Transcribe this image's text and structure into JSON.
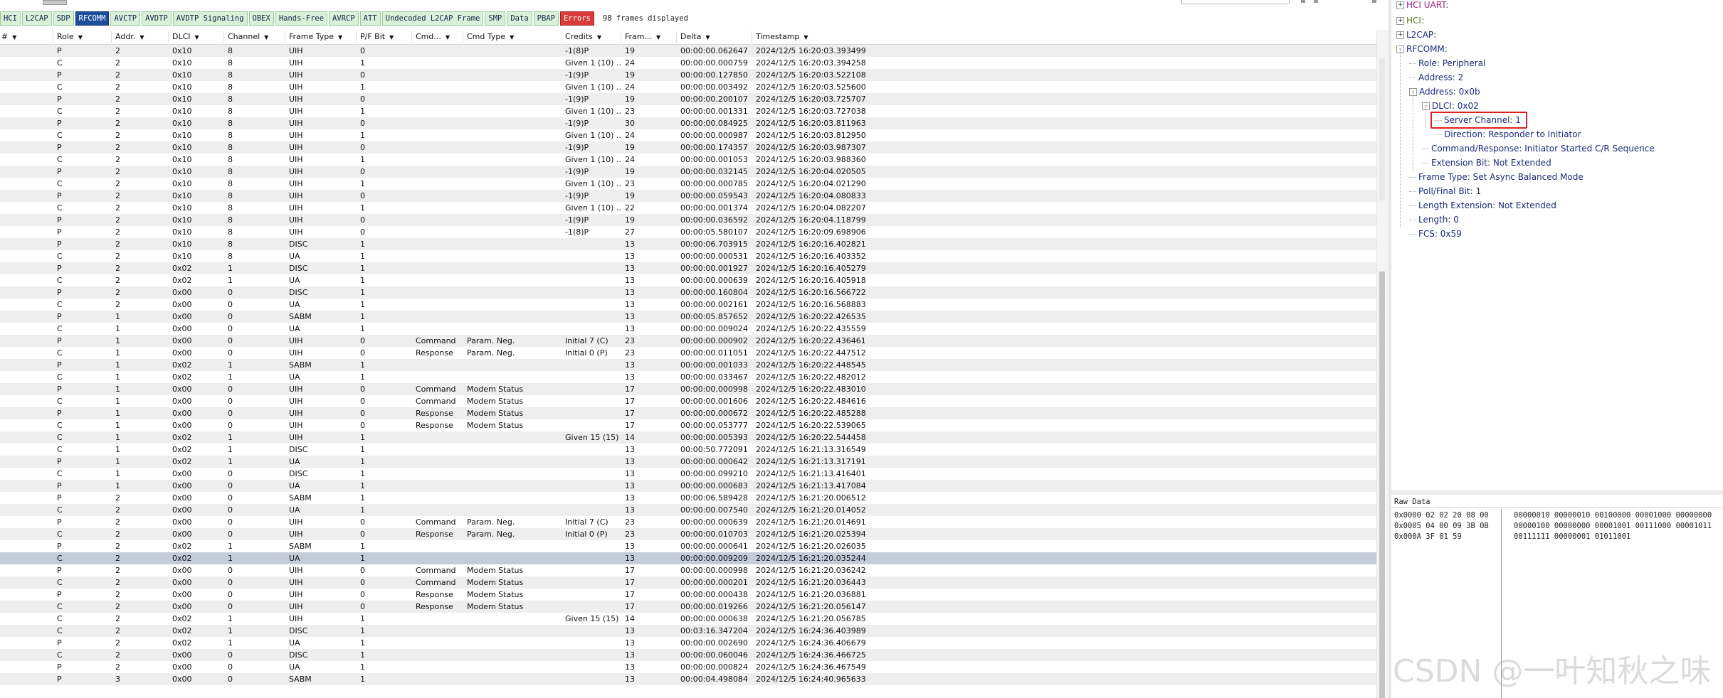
{
  "filter_bar": {
    "tabs": [
      {
        "label": "HCI",
        "state": "normal"
      },
      {
        "label": "L2CAP",
        "state": "normal"
      },
      {
        "label": "SDP",
        "state": "normal"
      },
      {
        "label": "RFCOMM",
        "state": "active"
      },
      {
        "label": "AVCTP",
        "state": "normal"
      },
      {
        "label": "AVDTP",
        "state": "normal"
      },
      {
        "label": "AVDTP Signaling",
        "state": "normal"
      },
      {
        "label": "OBEX",
        "state": "normal"
      },
      {
        "label": "Hands-Free",
        "state": "normal"
      },
      {
        "label": "AVRCP",
        "state": "normal"
      },
      {
        "label": "ATT",
        "state": "normal"
      },
      {
        "label": "Undecoded L2CAP Frame",
        "state": "normal"
      },
      {
        "label": "SMP",
        "state": "normal"
      },
      {
        "label": "Data",
        "state": "normal"
      },
      {
        "label": "PBAP",
        "state": "normal"
      },
      {
        "label": "Errors",
        "state": "error"
      }
    ],
    "frames_displayed": "98 frames displayed"
  },
  "table": {
    "headers": [
      "#",
      "Role",
      "Addr.",
      "DLCI",
      "Channel",
      "Frame Type",
      "P/F Bit",
      "Cmd...",
      "Cmd Type",
      "Credits",
      "Fram...",
      "Delta",
      "Timestamp"
    ],
    "selected_row": 42,
    "rows": [
      [
        "",
        "P",
        "2",
        "0x10",
        "8",
        "UIH",
        "0",
        "",
        "",
        "-1(8)P",
        "19",
        "00:00:00.062647",
        "2024/12/5 16:20:03.393499"
      ],
      [
        "",
        "C",
        "2",
        "0x10",
        "8",
        "UIH",
        "1",
        "",
        "",
        "Given 1 (10) ...",
        "24",
        "00:00:00.000759",
        "2024/12/5 16:20:03.394258"
      ],
      [
        "",
        "P",
        "2",
        "0x10",
        "8",
        "UIH",
        "0",
        "",
        "",
        "-1(9)P",
        "19",
        "00:00:00.127850",
        "2024/12/5 16:20:03.522108"
      ],
      [
        "",
        "C",
        "2",
        "0x10",
        "8",
        "UIH",
        "1",
        "",
        "",
        "Given 1 (10) ...",
        "24",
        "00:00:00.003492",
        "2024/12/5 16:20:03.525600"
      ],
      [
        "",
        "P",
        "2",
        "0x10",
        "8",
        "UIH",
        "0",
        "",
        "",
        "-1(9)P",
        "19",
        "00:00:00.200107",
        "2024/12/5 16:20:03.725707"
      ],
      [
        "",
        "C",
        "2",
        "0x10",
        "8",
        "UIH",
        "1",
        "",
        "",
        "Given 1 (10) ...",
        "23",
        "00:00:00.001331",
        "2024/12/5 16:20:03.727038"
      ],
      [
        "",
        "P",
        "2",
        "0x10",
        "8",
        "UIH",
        "0",
        "",
        "",
        "-1(9)P",
        "30",
        "00:00:00.084925",
        "2024/12/5 16:20:03.811963"
      ],
      [
        "",
        "C",
        "2",
        "0x10",
        "8",
        "UIH",
        "1",
        "",
        "",
        "Given 1 (10) ...",
        "24",
        "00:00:00.000987",
        "2024/12/5 16:20:03.812950"
      ],
      [
        "",
        "P",
        "2",
        "0x10",
        "8",
        "UIH",
        "0",
        "",
        "",
        "-1(9)P",
        "19",
        "00:00:00.174357",
        "2024/12/5 16:20:03.987307"
      ],
      [
        "",
        "C",
        "2",
        "0x10",
        "8",
        "UIH",
        "1",
        "",
        "",
        "Given 1 (10) ...",
        "24",
        "00:00:00.001053",
        "2024/12/5 16:20:03.988360"
      ],
      [
        "",
        "P",
        "2",
        "0x10",
        "8",
        "UIH",
        "0",
        "",
        "",
        "-1(9)P",
        "19",
        "00:00:00.032145",
        "2024/12/5 16:20:04.020505"
      ],
      [
        "",
        "C",
        "2",
        "0x10",
        "8",
        "UIH",
        "1",
        "",
        "",
        "Given 1 (10) ...",
        "23",
        "00:00:00.000785",
        "2024/12/5 16:20:04.021290"
      ],
      [
        "",
        "P",
        "2",
        "0x10",
        "8",
        "UIH",
        "0",
        "",
        "",
        "-1(9)P",
        "19",
        "00:00:00.059543",
        "2024/12/5 16:20:04.080833"
      ],
      [
        "",
        "C",
        "2",
        "0x10",
        "8",
        "UIH",
        "1",
        "",
        "",
        "Given 1 (10) ...",
        "22",
        "00:00:00.001374",
        "2024/12/5 16:20:04.082207"
      ],
      [
        "",
        "P",
        "2",
        "0x10",
        "8",
        "UIH",
        "0",
        "",
        "",
        "-1(9)P",
        "19",
        "00:00:00.036592",
        "2024/12/5 16:20:04.118799"
      ],
      [
        "",
        "P",
        "2",
        "0x10",
        "8",
        "UIH",
        "0",
        "",
        "",
        "-1(8)P",
        "27",
        "00:00:05.580107",
        "2024/12/5 16:20:09.698906"
      ],
      [
        "",
        "P",
        "2",
        "0x10",
        "8",
        "DISC",
        "1",
        "",
        "",
        "",
        "13",
        "00:00:06.703915",
        "2024/12/5 16:20:16.402821"
      ],
      [
        "",
        "C",
        "2",
        "0x10",
        "8",
        "UA",
        "1",
        "",
        "",
        "",
        "13",
        "00:00:00.000531",
        "2024/12/5 16:20:16.403352"
      ],
      [
        "",
        "P",
        "2",
        "0x02",
        "1",
        "DISC",
        "1",
        "",
        "",
        "",
        "13",
        "00:00:00.001927",
        "2024/12/5 16:20:16.405279"
      ],
      [
        "",
        "C",
        "2",
        "0x02",
        "1",
        "UA",
        "1",
        "",
        "",
        "",
        "13",
        "00:00:00.000639",
        "2024/12/5 16:20:16.405918"
      ],
      [
        "",
        "P",
        "2",
        "0x00",
        "0",
        "DISC",
        "1",
        "",
        "",
        "",
        "13",
        "00:00:00.160804",
        "2024/12/5 16:20:16.566722"
      ],
      [
        "",
        "C",
        "2",
        "0x00",
        "0",
        "UA",
        "1",
        "",
        "",
        "",
        "13",
        "00:00:00.002161",
        "2024/12/5 16:20:16.568883"
      ],
      [
        "",
        "P",
        "1",
        "0x00",
        "0",
        "SABM",
        "1",
        "",
        "",
        "",
        "13",
        "00:00:05.857652",
        "2024/12/5 16:20:22.426535"
      ],
      [
        "",
        "C",
        "1",
        "0x00",
        "0",
        "UA",
        "1",
        "",
        "",
        "",
        "13",
        "00:00:00.009024",
        "2024/12/5 16:20:22.435559"
      ],
      [
        "",
        "P",
        "1",
        "0x00",
        "0",
        "UIH",
        "0",
        "Command",
        "Param. Neg.",
        "Initial 7 (C)",
        "23",
        "00:00:00.000902",
        "2024/12/5 16:20:22.436461"
      ],
      [
        "",
        "C",
        "1",
        "0x00",
        "0",
        "UIH",
        "0",
        "Response",
        "Param. Neg.",
        "Initial 0 (P)",
        "23",
        "00:00:00.011051",
        "2024/12/5 16:20:22.447512"
      ],
      [
        "",
        "P",
        "1",
        "0x02",
        "1",
        "SABM",
        "1",
        "",
        "",
        "",
        "13",
        "00:00:00.001033",
        "2024/12/5 16:20:22.448545"
      ],
      [
        "",
        "C",
        "1",
        "0x02",
        "1",
        "UA",
        "1",
        "",
        "",
        "",
        "13",
        "00:00:00.033467",
        "2024/12/5 16:20:22.482012"
      ],
      [
        "",
        "P",
        "1",
        "0x00",
        "0",
        "UIH",
        "0",
        "Command",
        "Modem Status",
        "",
        "17",
        "00:00:00.000998",
        "2024/12/5 16:20:22.483010"
      ],
      [
        "",
        "C",
        "1",
        "0x00",
        "0",
        "UIH",
        "0",
        "Command",
        "Modem Status",
        "",
        "17",
        "00:00:00.001606",
        "2024/12/5 16:20:22.484616"
      ],
      [
        "",
        "P",
        "1",
        "0x00",
        "0",
        "UIH",
        "0",
        "Response",
        "Modem Status",
        "",
        "17",
        "00:00:00.000672",
        "2024/12/5 16:20:22.485288"
      ],
      [
        "",
        "C",
        "1",
        "0x00",
        "0",
        "UIH",
        "0",
        "Response",
        "Modem Status",
        "",
        "17",
        "00:00:00.053777",
        "2024/12/5 16:20:22.539065"
      ],
      [
        "",
        "C",
        "1",
        "0x02",
        "1",
        "UIH",
        "1",
        "",
        "",
        "Given 15 (15) ...",
        "14",
        "00:00:00.005393",
        "2024/12/5 16:20:22.544458"
      ],
      [
        "",
        "C",
        "1",
        "0x02",
        "1",
        "DISC",
        "1",
        "",
        "",
        "",
        "13",
        "00:00:50.772091",
        "2024/12/5 16:21:13.316549"
      ],
      [
        "",
        "P",
        "1",
        "0x02",
        "1",
        "UA",
        "1",
        "",
        "",
        "",
        "13",
        "00:00:00.000642",
        "2024/12/5 16:21:13.317191"
      ],
      [
        "",
        "C",
        "1",
        "0x00",
        "0",
        "DISC",
        "1",
        "",
        "",
        "",
        "13",
        "00:00:00.099210",
        "2024/12/5 16:21:13.416401"
      ],
      [
        "",
        "P",
        "1",
        "0x00",
        "0",
        "UA",
        "1",
        "",
        "",
        "",
        "13",
        "00:00:00.000683",
        "2024/12/5 16:21:13.417084"
      ],
      [
        "",
        "P",
        "2",
        "0x00",
        "0",
        "SABM",
        "1",
        "",
        "",
        "",
        "13",
        "00:00:06.589428",
        "2024/12/5 16:21:20.006512"
      ],
      [
        "",
        "C",
        "2",
        "0x00",
        "0",
        "UA",
        "1",
        "",
        "",
        "",
        "13",
        "00:00:00.007540",
        "2024/12/5 16:21:20.014052"
      ],
      [
        "",
        "P",
        "2",
        "0x00",
        "0",
        "UIH",
        "0",
        "Command",
        "Param. Neg.",
        "Initial 7 (C)",
        "23",
        "00:00:00.000639",
        "2024/12/5 16:21:20.014691"
      ],
      [
        "",
        "C",
        "2",
        "0x00",
        "0",
        "UIH",
        "0",
        "Response",
        "Param. Neg.",
        "Initial 0 (P)",
        "23",
        "00:00:00.010703",
        "2024/12/5 16:21:20.025394"
      ],
      [
        "",
        "P",
        "2",
        "0x02",
        "1",
        "SABM",
        "1",
        "",
        "",
        "",
        "13",
        "00:00:00.000641",
        "2024/12/5 16:21:20.026035"
      ],
      [
        "",
        "C",
        "2",
        "0x02",
        "1",
        "UA",
        "1",
        "",
        "",
        "",
        "13",
        "00:00:00.009209",
        "2024/12/5 16:21:20.035244"
      ],
      [
        "",
        "P",
        "2",
        "0x00",
        "0",
        "UIH",
        "0",
        "Command",
        "Modem Status",
        "",
        "17",
        "00:00:00.000998",
        "2024/12/5 16:21:20.036242"
      ],
      [
        "",
        "C",
        "2",
        "0x00",
        "0",
        "UIH",
        "0",
        "Command",
        "Modem Status",
        "",
        "17",
        "00:00:00.000201",
        "2024/12/5 16:21:20.036443"
      ],
      [
        "",
        "P",
        "2",
        "0x00",
        "0",
        "UIH",
        "0",
        "Response",
        "Modem Status",
        "",
        "17",
        "00:00:00.000438",
        "2024/12/5 16:21:20.036881"
      ],
      [
        "",
        "C",
        "2",
        "0x00",
        "0",
        "UIH",
        "0",
        "Response",
        "Modem Status",
        "",
        "17",
        "00:00:00.019266",
        "2024/12/5 16:21:20.056147"
      ],
      [
        "",
        "C",
        "2",
        "0x02",
        "1",
        "UIH",
        "1",
        "",
        "",
        "Given 15 (15) ...",
        "14",
        "00:00:00.000638",
        "2024/12/5 16:21:20.056785"
      ],
      [
        "",
        "C",
        "2",
        "0x02",
        "1",
        "DISC",
        "1",
        "",
        "",
        "",
        "13",
        "00:03:16.347204",
        "2024/12/5 16:24:36.403989"
      ],
      [
        "",
        "P",
        "2",
        "0x02",
        "1",
        "UA",
        "1",
        "",
        "",
        "",
        "13",
        "00:00:00.002690",
        "2024/12/5 16:24:36.406679"
      ],
      [
        "",
        "C",
        "2",
        "0x00",
        "0",
        "DISC",
        "1",
        "",
        "",
        "",
        "13",
        "00:00:00.060046",
        "2024/12/5 16:24:36.466725"
      ],
      [
        "",
        "P",
        "2",
        "0x00",
        "0",
        "UA",
        "1",
        "",
        "",
        "",
        "13",
        "00:00:00.000824",
        "2024/12/5 16:24:36.467549"
      ],
      [
        "",
        "P",
        "3",
        "0x00",
        "0",
        "SABM",
        "1",
        "",
        "",
        "",
        "13",
        "00:00:04.498084",
        "2024/12/5 16:24:40.965633"
      ]
    ]
  },
  "tree": {
    "nodes": [
      {
        "label": "HCI UART:",
        "box": "+",
        "color": "#9a1f8a"
      },
      {
        "label": "HCI:",
        "box": "+",
        "color": "#5a7a1a"
      },
      {
        "label": "L2CAP:",
        "box": "+",
        "color": "#1a2b7a"
      },
      {
        "label": "RFCOMM:",
        "box": "-",
        "color": "#1a2b7a"
      },
      {
        "label": "Role: Peripheral",
        "box": "",
        "color": "#1a2b7a"
      },
      {
        "label": "Address: 2",
        "box": "",
        "color": "#1a2b7a"
      },
      {
        "label": "Address: 0x0b",
        "box": "-",
        "color": "#1a2b7a"
      },
      {
        "label": "DLCI: 0x02",
        "box": "-",
        "color": "#1a2b7a"
      },
      {
        "label": "Server Channel: 1",
        "box": "",
        "color": "#1a2b7a"
      },
      {
        "label": "Direction: Responder to Initiator",
        "box": "",
        "color": "#1a2b7a"
      },
      {
        "label": "Command/Response: Initiator Started C/R Sequence",
        "box": "",
        "color": "#1a2b7a"
      },
      {
        "label": "Extension Bit: Not Extended",
        "box": "",
        "color": "#1a2b7a"
      },
      {
        "label": "Frame Type: Set Async Balanced Mode",
        "box": "",
        "color": "#1a2b7a"
      },
      {
        "label": "Poll/Final Bit: 1",
        "box": "",
        "color": "#1a2b7a"
      },
      {
        "label": "Length Extension: Not Extended",
        "box": "",
        "color": "#1a2b7a"
      },
      {
        "label": "Length: 0",
        "box": "",
        "color": "#1a2b7a"
      },
      {
        "label": "FCS: 0x59",
        "box": "",
        "color": "#1a2b7a"
      }
    ]
  },
  "raw_data": {
    "title": "Raw Data",
    "hex_lines": [
      "0x0000  02 02 20 08 00",
      "0x0005  04 00 09 3B 0B",
      "0x000A  3F 01 59"
    ],
    "bin_lines": [
      "00000010 00000010 00100000 00001000 00000000",
      "00000100 00000000 00001001 00111000 00001011",
      "00111111 00000001 01011001"
    ]
  },
  "watermark": "CSDN @一叶知秋之味"
}
